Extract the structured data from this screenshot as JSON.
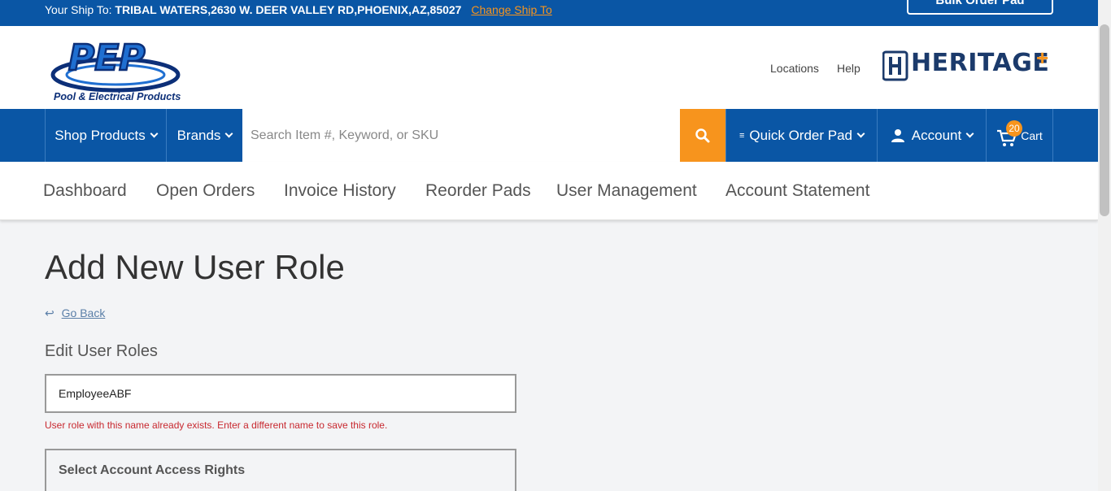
{
  "shipbar": {
    "label": "Your Ship To:",
    "address": "TRIBAL WATERS,2630 W. DEER VALLEY RD,PHOENIX,AZ,85027",
    "change_link": "Change Ship To",
    "bulk_button": "Bulk Order Pad"
  },
  "header": {
    "logo_caption": "Pool & Electrical Products",
    "locations": "Locations",
    "help": "Help",
    "heritage_text": "HERITAGE",
    "heritage_plus": "+"
  },
  "nav": {
    "shop_products": "Shop Products",
    "brands": "Brands",
    "search_placeholder": "Search Item #, Keyword, or SKU",
    "quick_order_pad": "Quick Order Pad",
    "account": "Account",
    "cart_label": "Cart",
    "cart_count": "20"
  },
  "subnav": {
    "items": [
      "Dashboard",
      "Open Orders",
      "Invoice History",
      "Reorder Pads",
      "User Management",
      "Account Statement"
    ]
  },
  "main": {
    "title": "Add New User Role",
    "go_back": "Go Back",
    "section_title": "Edit User Roles",
    "role_name_value": "EmployeeABF",
    "error_message": "User role with this name already exists. Enter a different name to save this role.",
    "rights_title": "Select Account Access Rights"
  },
  "colors": {
    "brand_blue": "#0a56a5",
    "accent_orange": "#f7941d",
    "error_red": "#c8282f"
  }
}
